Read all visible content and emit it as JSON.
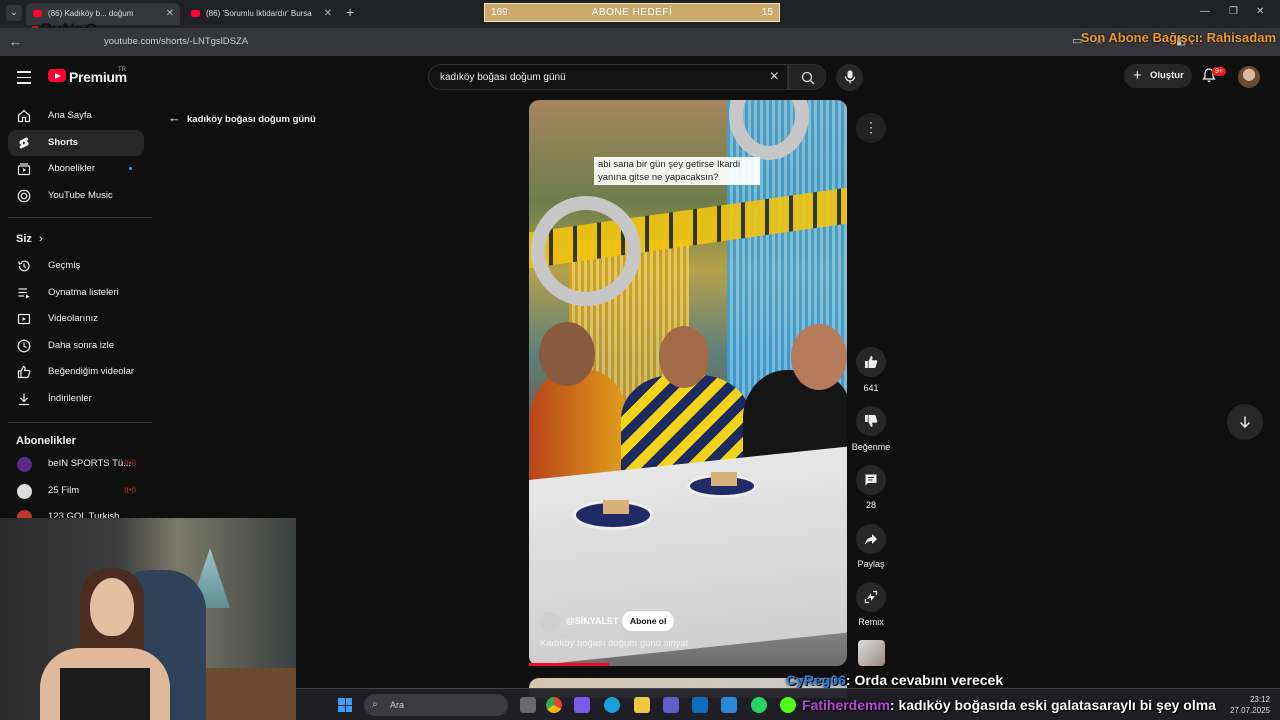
{
  "browser": {
    "tabs": [
      {
        "label": "(86) Kadıköy b... doğum"
      },
      {
        "label": "(86) 'Sorumlu İktidardır' Bursa"
      }
    ],
    "url": "youtube.com/shorts/-LNTgslDSZA"
  },
  "overlays": {
    "goal_left": "169",
    "goal_title": "ABONE HEDEFİ",
    "goal_right": "15",
    "logo_a": "ByNoG",
    "logo_b": "a",
    "donor": "Son Abone Bağışçı: Rahisadam"
  },
  "header": {
    "brand": "Premium",
    "brand_region": "TR",
    "search_query": "kadıköy boğası doğum günü",
    "create_label": "Oluştur",
    "notif_count": "9+"
  },
  "sidebar": {
    "items": [
      {
        "label": "Ana Sayfa"
      },
      {
        "label": "Shorts"
      },
      {
        "label": "Abonelikler"
      },
      {
        "label": "YouTube Music"
      }
    ],
    "you_heading": "Siz",
    "you_items": [
      {
        "label": "Geçmiş"
      },
      {
        "label": "Oynatma listeleri"
      },
      {
        "label": "Videolarınız"
      },
      {
        "label": "Daha sonra izle"
      },
      {
        "label": "Beğendiğim videolar"
      },
      {
        "label": "İndirilenler"
      }
    ],
    "subs_heading": "Abonelikler",
    "subs": [
      {
        "label": "beIN SPORTS Tü..."
      },
      {
        "label": "25 Film"
      },
      {
        "label": "123 GOL Turkish"
      }
    ]
  },
  "shorts": {
    "back_title": "kadıköy boğası doğum günü",
    "caption": "abi sana bir gün şey getirse Ikardi yanına gitse ne yapacaksın?",
    "channel": "@SİNYALET",
    "subscribe_label": "Abone ol",
    "title": "Kadıköy boğası doğum günü sinyal",
    "progress": 0.25,
    "actions": {
      "likes": "641",
      "dislike_label": "Beğenme",
      "comments": "28",
      "share_label": "Paylaş",
      "remix_label": "Remix"
    }
  },
  "chat": [
    {
      "user": "CyReg06",
      "message": ": Orda cevabını verecek"
    },
    {
      "user": "Fatiherdemm",
      "message": ": kadıköy boğasıda eski galatasaraylı bi şey olma"
    }
  ],
  "taskbar": {
    "search_label": "Ara",
    "time": "23:12",
    "date": "27.07.2025"
  }
}
